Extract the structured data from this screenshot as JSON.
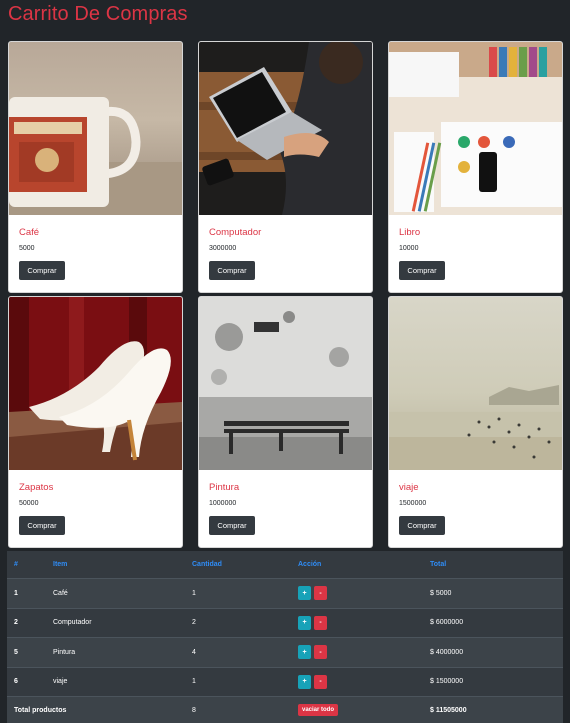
{
  "header": {
    "title": "Carrito De Compras"
  },
  "products": [
    {
      "name": "Café",
      "price": "5000",
      "button": "Comprar",
      "image": "coffee-mug-photo"
    },
    {
      "name": "Computador",
      "price": "3000000",
      "button": "Comprar",
      "image": "laptop-photo"
    },
    {
      "name": "Libro",
      "price": "10000",
      "button": "Comprar",
      "image": "desk-notebook-photo"
    },
    {
      "name": "Zapatos",
      "price": "50000",
      "button": "Comprar",
      "image": "white-heels-photo"
    },
    {
      "name": "Pintura",
      "price": "1000000",
      "button": "Comprar",
      "image": "painted-wall-bench-photo"
    },
    {
      "name": "viaje",
      "price": "1500000",
      "button": "Comprar",
      "image": "beach-photo"
    }
  ],
  "cart": {
    "headers": {
      "num": "#",
      "item": "Item",
      "qty": "Cantidad",
      "action": "Acción",
      "total": "Total"
    },
    "rows": [
      {
        "num": "1",
        "item": "Café",
        "qty": "1",
        "plus": "+",
        "minus": "-",
        "total": "$ 5000"
      },
      {
        "num": "2",
        "item": "Computador",
        "qty": "2",
        "plus": "+",
        "minus": "-",
        "total": "$ 6000000"
      },
      {
        "num": "5",
        "item": "Pintura",
        "qty": "4",
        "plus": "+",
        "minus": "-",
        "total": "$ 4000000"
      },
      {
        "num": "6",
        "item": "viaje",
        "qty": "1",
        "plus": "+",
        "minus": "-",
        "total": "$ 1500000"
      }
    ],
    "footer": {
      "label": "Total productos",
      "qty": "8",
      "clear_button": "vaciar todo",
      "total": "$ 11505000"
    }
  }
}
